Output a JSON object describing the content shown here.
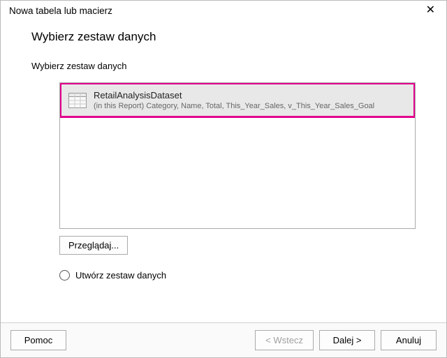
{
  "titlebar": {
    "title": "Nowa tabela lub macierz"
  },
  "content": {
    "heading": "Wybierz zestaw danych",
    "subtext": "Wybierz zestaw danych",
    "dataset": {
      "name": "RetailAnalysisDataset",
      "fields": "(in this Report) Category, Name, Total, This_Year_Sales, v_This_Year_Sales_Goal"
    },
    "browse_label": "Przeglądaj...",
    "create_label": "Utwórz zestaw danych"
  },
  "footer": {
    "help_label": "Pomoc",
    "back_label": "< Wstecz",
    "next_label": "Dalej >",
    "cancel_label": "Anuluj"
  }
}
